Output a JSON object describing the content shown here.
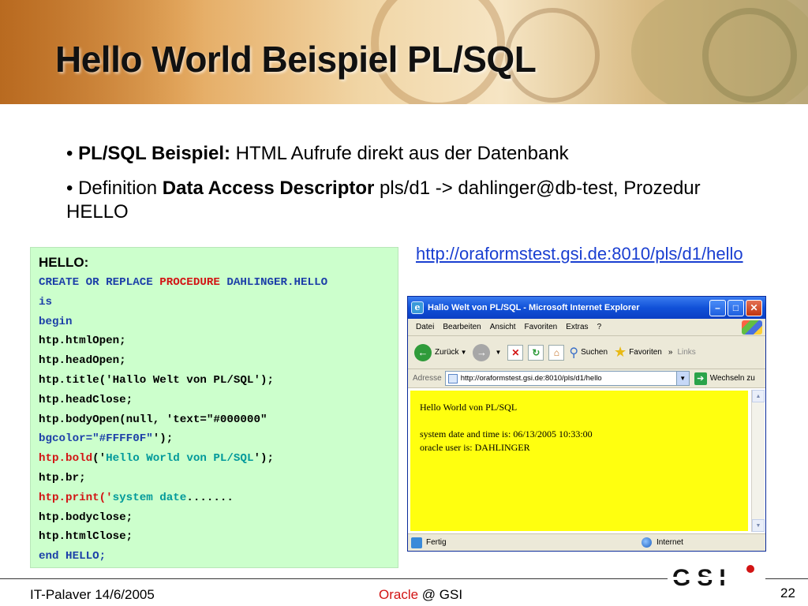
{
  "slide": {
    "title": "Hello World Beispiel PL/SQL",
    "bullets": [
      {
        "prefix": "• ",
        "bold": "PL/SQL Beispiel:",
        "text": " HTML Aufrufe direkt aus der Datenbank"
      },
      {
        "prefix": "• Definition ",
        "bold": "Data Access Descriptor",
        "text": " pls/d1 -> dahlinger@db-test, Prozedur HELLO"
      }
    ],
    "url": "http://oraformstest.gsi.de:8010/pls/d1/hello"
  },
  "code": {
    "header": "HELLO:",
    "lines": [
      [
        {
          "t": "CREATE OR REPLACE ",
          "c": "blue"
        },
        {
          "t": "PROCEDURE",
          "c": "red"
        },
        {
          "t": " DAHLINGER.HELLO",
          "c": "blue"
        }
      ],
      [
        {
          "t": "is",
          "c": "blue"
        }
      ],
      [
        {
          "t": "begin",
          "c": "blue"
        }
      ],
      [
        {
          "t": "htp.htmlOpen;",
          "c": "black"
        }
      ],
      [
        {
          "t": "htp.headOpen;",
          "c": "black"
        }
      ],
      [
        {
          "t": "htp.title('Hallo Welt von PL/SQL');",
          "c": "black"
        }
      ],
      [
        {
          "t": "htp.headClose;",
          "c": "black"
        }
      ],
      [
        {
          "t": "htp.bodyOpen(null, 'text=\"#000000\"",
          "c": "black"
        }
      ],
      [
        {
          "t": "bgcolor=\"#FFFF0F\"",
          "c": "blue"
        },
        {
          "t": "');",
          "c": "black"
        }
      ],
      [
        {
          "t": "htp.bold",
          "c": "red"
        },
        {
          "t": "('",
          "c": "black"
        },
        {
          "t": "Hello World von PL/SQL",
          "c": "teal"
        },
        {
          "t": "');",
          "c": "black"
        }
      ],
      [
        {
          "t": "htp.br;",
          "c": "black"
        }
      ],
      [
        {
          "t": "htp.print('",
          "c": "red"
        },
        {
          "t": "system date",
          "c": "teal"
        },
        {
          "t": ".......",
          "c": "black"
        }
      ],
      [
        {
          "t": "htp.bodyclose;",
          "c": "black"
        }
      ],
      [
        {
          "t": " htp.htmlClose;",
          "c": "black"
        }
      ],
      [
        {
          "t": "end HELLO;",
          "c": "blue"
        }
      ]
    ]
  },
  "browser": {
    "title": "Hallo Welt von PL/SQL - Microsoft Internet Explorer",
    "menu": [
      "Datei",
      "Bearbeiten",
      "Ansicht",
      "Favoriten",
      "Extras",
      "?"
    ],
    "toolbar": {
      "back": "Zurück",
      "search": "Suchen",
      "favorites": "Favoriten",
      "more": "»",
      "links": "Links"
    },
    "address_label": "Adresse",
    "address_value": "http://oraformstest.gsi.de:8010/pls/d1/hello",
    "go_label": "Wechseln zu",
    "page": {
      "heading": "Hello World von PL/SQL",
      "line1": "system date and time is: 06/13/2005 10:33:00",
      "line2": "oracle user is: DAHLINGER",
      "bgcolor": "#FFFF0F"
    },
    "status_left": "Fertig",
    "status_zone": "Internet"
  },
  "footer": {
    "left": "IT-Palaver 14/6/2005",
    "center_brand": "Oracle",
    "center_rest": " @ GSI",
    "page_number": "22",
    "logo_text": "GSI"
  },
  "colors": {
    "code_bg": "#CCFFCC",
    "keyword_blue": "#1C3FA8",
    "keyword_red": "#D21414",
    "string_teal": "#00999A",
    "link": "#1A3FD1"
  }
}
